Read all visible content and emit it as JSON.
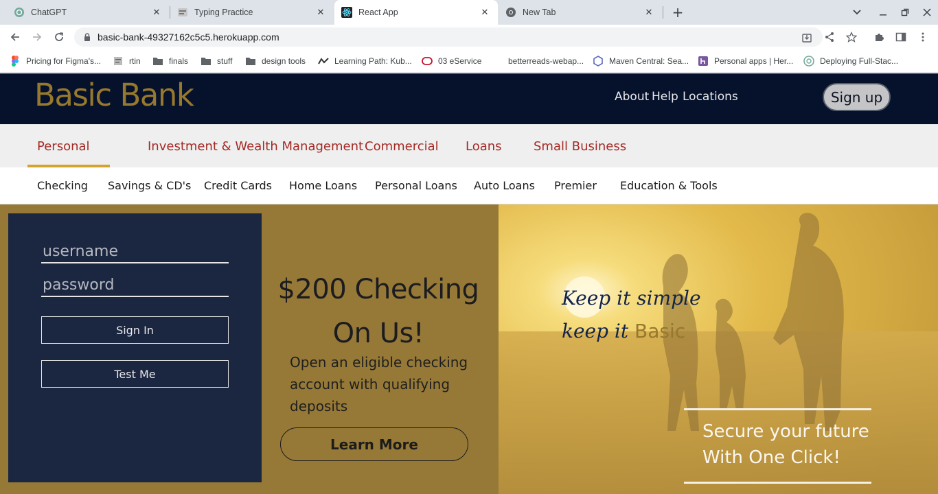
{
  "browser": {
    "tabs": [
      {
        "title": "ChatGPT",
        "icon": "chatgpt-icon"
      },
      {
        "title": "Typing Practice",
        "icon": "typing-icon"
      },
      {
        "title": "React App",
        "icon": "react-icon"
      },
      {
        "title": "New Tab",
        "icon": "chrome-icon"
      }
    ],
    "url": "basic-bank-49327162c5c5.herokuapp.com",
    "bookmarks": [
      {
        "label": "Pricing for Figma's...",
        "icon": "figma-icon"
      },
      {
        "label": "rtin",
        "icon": "page-icon"
      },
      {
        "label": "finals",
        "icon": "folder-icon"
      },
      {
        "label": "stuff",
        "icon": "folder-icon"
      },
      {
        "label": "design tools",
        "icon": "folder-icon"
      },
      {
        "label": "Learning Path: Kub...",
        "icon": "path-icon"
      },
      {
        "label": "03 eService",
        "icon": "eservice-icon"
      },
      {
        "label": "betterreads-webap...",
        "icon": "blank-icon"
      },
      {
        "label": "Maven Central: Sea...",
        "icon": "maven-icon"
      },
      {
        "label": "Personal apps | Her...",
        "icon": "heroku-icon"
      },
      {
        "label": "Deploying Full-Stac...",
        "icon": "chatgpt-icon"
      }
    ]
  },
  "header": {
    "logo": "Basic Bank",
    "links": [
      "About",
      "Help",
      "Locations"
    ],
    "signup": "Sign up"
  },
  "categories": [
    "Personal",
    "Investment & Wealth Management",
    "Commercial",
    "Loans",
    "Small Business"
  ],
  "active_category": "Personal",
  "subnav": [
    "Checking",
    "Savings & CD's",
    "Credit Cards",
    "Home Loans",
    "Personal Loans",
    "Auto Loans",
    "Premier",
    "Education & Tools"
  ],
  "login": {
    "username_placeholder": "username",
    "password_placeholder": "password",
    "signin": "Sign In",
    "testme": "Test Me"
  },
  "promo": {
    "title_line1": "$200 Checking",
    "title_line2": "On Us!",
    "text": "Open an eligible checking account with qualifying deposits",
    "button": "Learn More"
  },
  "hero_image": {
    "tagline_line1": "Keep it simple",
    "tagline_line2_prefix": "keep it ",
    "tagline_line2_accent": "Basic",
    "cta_line1": "Secure your future",
    "cta_line2": "With One Click!"
  },
  "colors": {
    "navy": "#06122b",
    "gold": "#96782e",
    "red": "#a32a25",
    "underline": "#d4a32b",
    "login_panel": "#1b2640"
  }
}
